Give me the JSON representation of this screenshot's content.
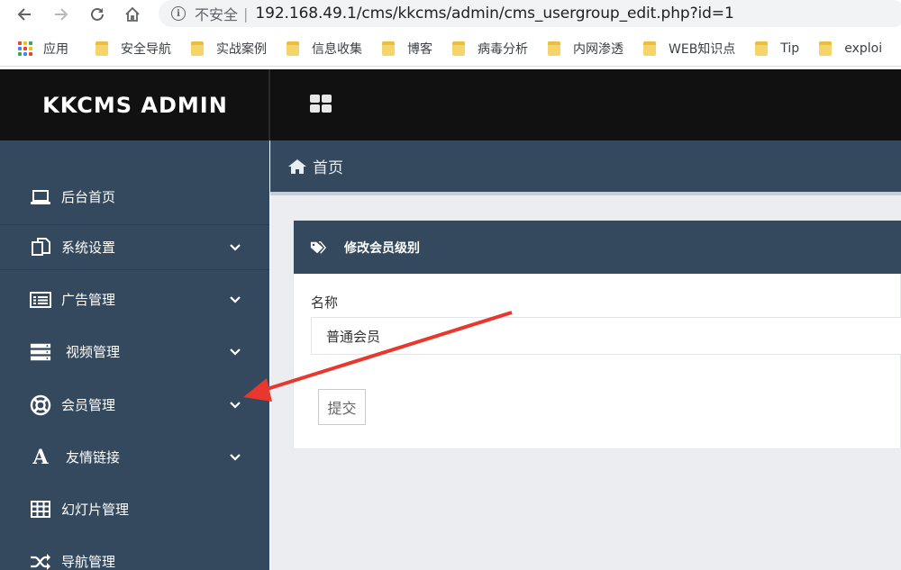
{
  "browser": {
    "security_label": "不安全",
    "separator": "|",
    "url": "192.168.49.1/cms/kkcms/admin/cms_usergroup_edit.php?id=1",
    "bookmarks": [
      "应用",
      "安全导航",
      "实战案例",
      "信息收集",
      "博客",
      "病毒分析",
      "内网渗透",
      "WEB知识点",
      "Tip",
      "exploi"
    ]
  },
  "header": {
    "logo": "KKCMS ADMIN"
  },
  "sidebar": {
    "items": [
      {
        "label": "后台首页",
        "icon": "laptop-icon",
        "has_children": false
      },
      {
        "label": "系统设置",
        "icon": "copy-icon",
        "has_children": true
      },
      {
        "label": "广告管理",
        "icon": "list-alt-icon",
        "has_children": true
      },
      {
        "label": "视频管理",
        "icon": "server-icon",
        "has_children": true
      },
      {
        "label": "会员管理",
        "icon": "life-ring-icon",
        "has_children": true
      },
      {
        "label": "友情链接",
        "icon": "font-icon",
        "has_children": true
      },
      {
        "label": "幻灯片管理",
        "icon": "table-icon",
        "has_children": false
      },
      {
        "label": "导航管理",
        "icon": "random-icon",
        "has_children": false
      }
    ]
  },
  "breadcrumb": {
    "home": "首页"
  },
  "panel": {
    "title": "修改会员级别",
    "field_label": "名称",
    "field_value": "普通会员",
    "submit_label": "提交"
  },
  "colors": {
    "sidebar_bg": "#34495e",
    "topbar_bg": "#111111",
    "annotation_arrow": "#e8372c"
  }
}
